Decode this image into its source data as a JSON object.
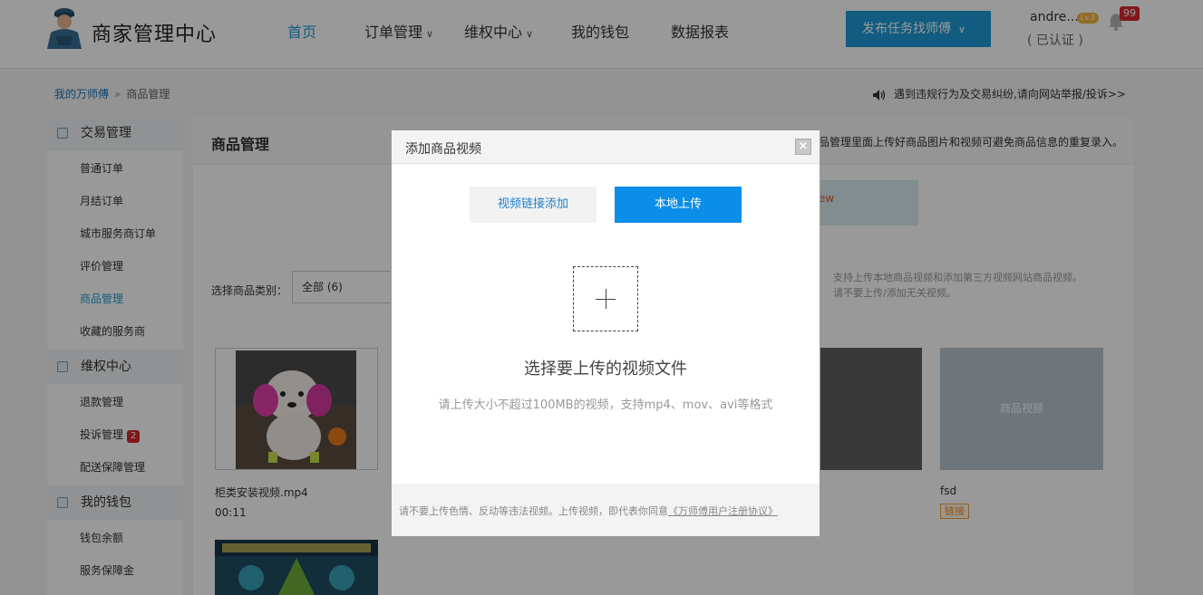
{
  "header": {
    "logo_text": "商家管理中心",
    "nav": [
      {
        "label": "首页",
        "active": true
      },
      {
        "label": "订单管理",
        "caret": "∨"
      },
      {
        "label": "维权中心",
        "caret": "∨"
      },
      {
        "label": "我的钱包"
      },
      {
        "label": "数据报表"
      }
    ],
    "publish_button": "发布任务找师傅",
    "publish_caret": "∨",
    "user_name": "andre...",
    "level_badge": "Lv.3",
    "verified": "( 已认证 )",
    "notification_count": "99"
  },
  "breadcrumb": {
    "root": "我的万师傅",
    "separator": "»",
    "current": "商品管理"
  },
  "notice": "遇到违规行为及交易纠纷,请向网站举报/投诉>>",
  "sidebar": {
    "groups": [
      {
        "title": "交易管理",
        "items": [
          "普通订单",
          "月结订单",
          "城市服务商订单",
          "评价管理",
          "商品管理",
          "收藏的服务商"
        ]
      },
      {
        "title": "维权中心",
        "items": [
          "退款管理",
          "投诉管理",
          "配送保障管理"
        ]
      },
      {
        "title": "我的钱包",
        "items": [
          "钱包余额",
          "服务保障金"
        ]
      }
    ],
    "active_item": "商品管理",
    "complaint_badge": "2"
  },
  "main": {
    "title": "商品管理",
    "tip": "品管理里面上传好商品图片和视频可避免商品信息的重复录入。",
    "upload_partial": "ew",
    "category_label": "选择商品类别：",
    "category_value": "全部 (6)",
    "side_tip_1": "支持上传本地商品视频和添加第三方视频网站商品视频。",
    "side_tip_2": "请不要上传/添加无关视频。",
    "cards": [
      {
        "name": "柜类安装视频.mp4",
        "duration": "00:11"
      },
      {
        "name": "fsd",
        "tag": "链接",
        "placeholder": "商品视频"
      }
    ]
  },
  "modal": {
    "title": "添加商品视频",
    "close": "×",
    "tab_link": "视频链接添加",
    "tab_local": "本地上传",
    "drop_title": "选择要上传的视频文件",
    "drop_hint": "请上传大小不超过100MB的视频，支持mp4、mov、avi等格式",
    "foot_text": "请不要上传色情、反动等违法视频。上传视频，即代表你同意",
    "foot_link": "《万师傅用户注册协议》"
  },
  "colors": {
    "accent": "#1d9ad6",
    "primary_button": "#0a8ee8",
    "badge_red": "#d7272c"
  }
}
